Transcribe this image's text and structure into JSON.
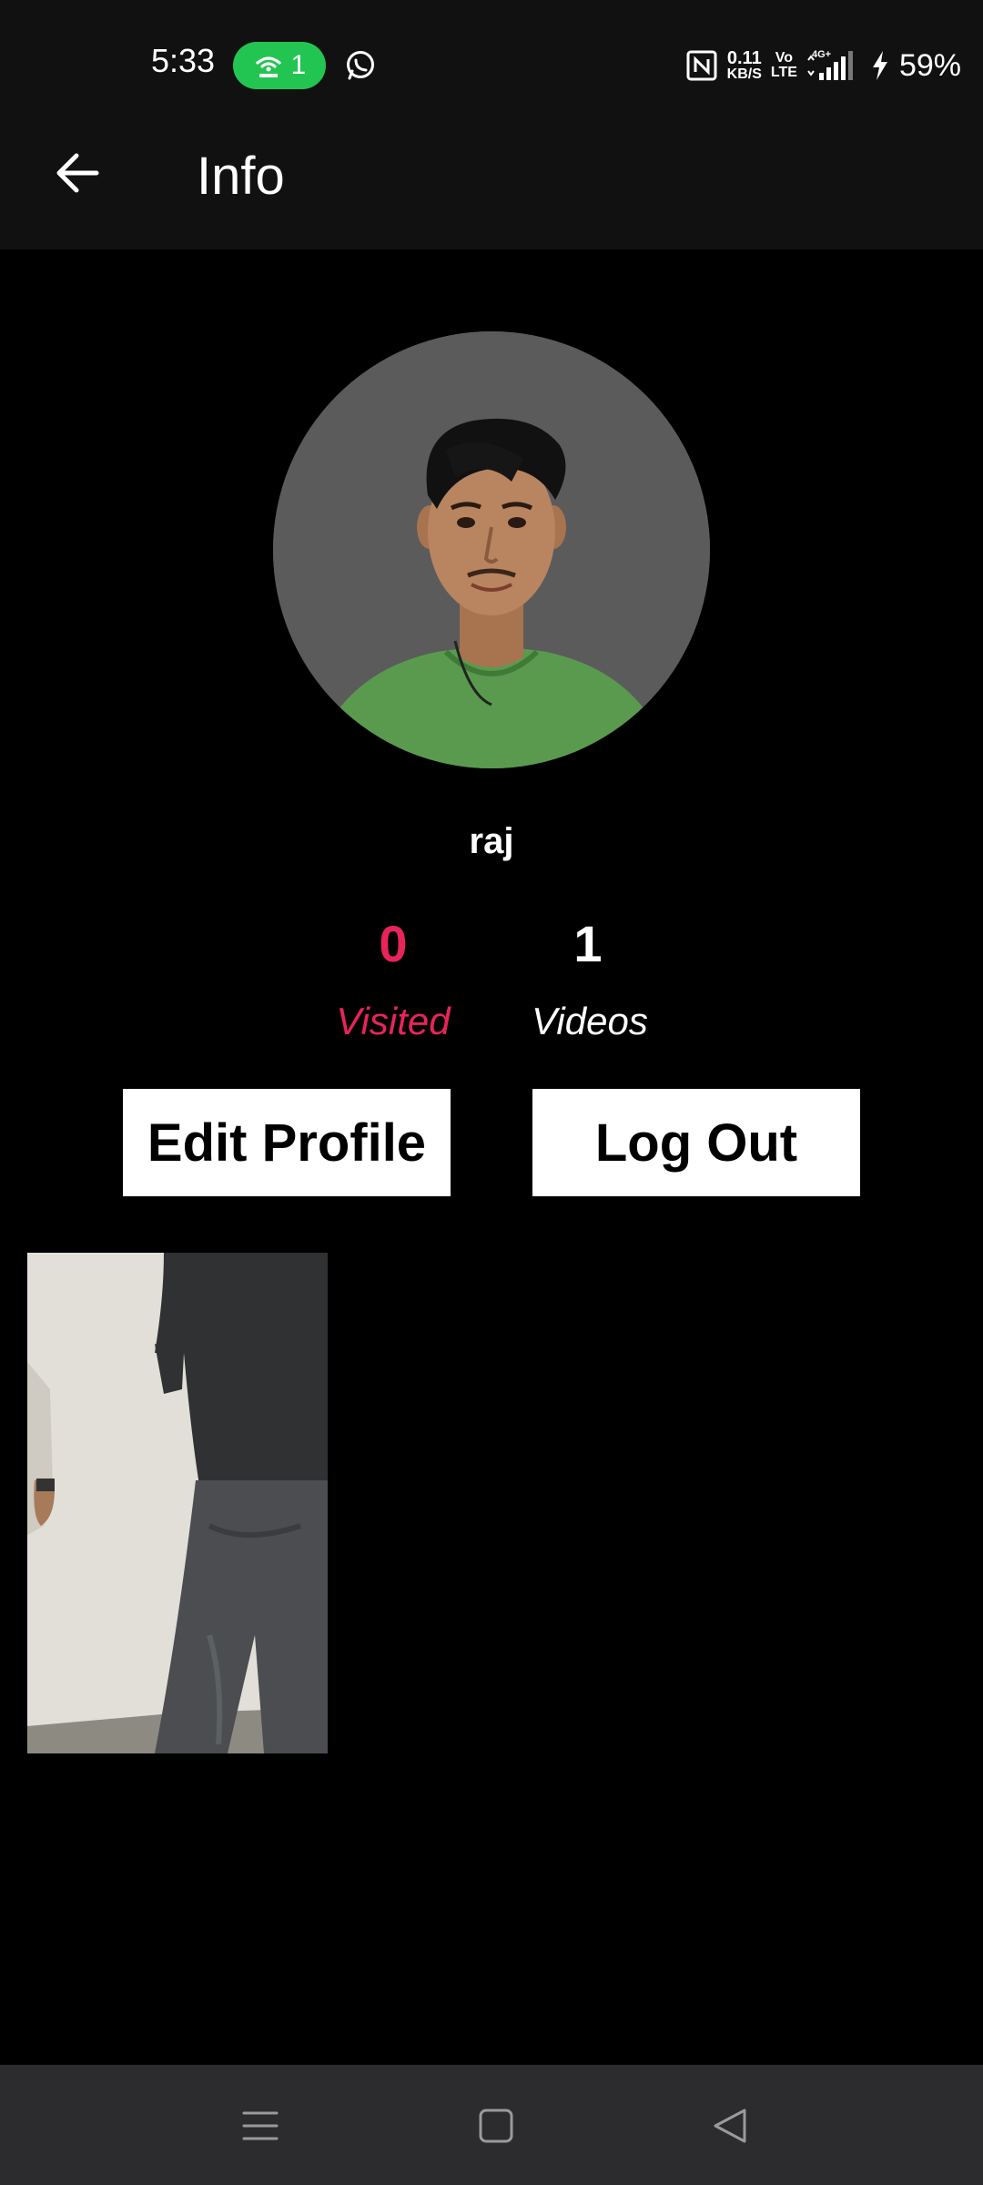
{
  "status_bar": {
    "time": "5:33",
    "hotspot_count": "1",
    "net_speed_value": "0.11",
    "net_speed_unit": "KB/S",
    "volte_top": "Vo",
    "volte_bottom": "LTE",
    "network_type": "4G+",
    "battery": "59%",
    "icons": [
      "hotspot-icon",
      "whatsapp-icon",
      "nfc-icon",
      "signal-icon",
      "charging-icon"
    ],
    "hotspot_color": "#23c552"
  },
  "app_bar": {
    "title": "Info",
    "back_icon": "arrow-left-icon"
  },
  "profile": {
    "username": "raj",
    "stats": [
      {
        "value": "0",
        "label": "Visited",
        "color": "#e8245a"
      },
      {
        "value": "1",
        "label": "Videos",
        "color": "#ffffff"
      }
    ]
  },
  "actions": {
    "edit_profile": "Edit Profile",
    "log_out": "Log Out"
  },
  "videos": {
    "count": 1
  },
  "nav_bar": {
    "buttons": [
      "menu-icon",
      "home-icon",
      "back-triangle-icon"
    ]
  },
  "colors": {
    "background": "#000000",
    "bar": "#111111",
    "accent": "#e8245a",
    "nav_bar": "#2c2c2e"
  }
}
